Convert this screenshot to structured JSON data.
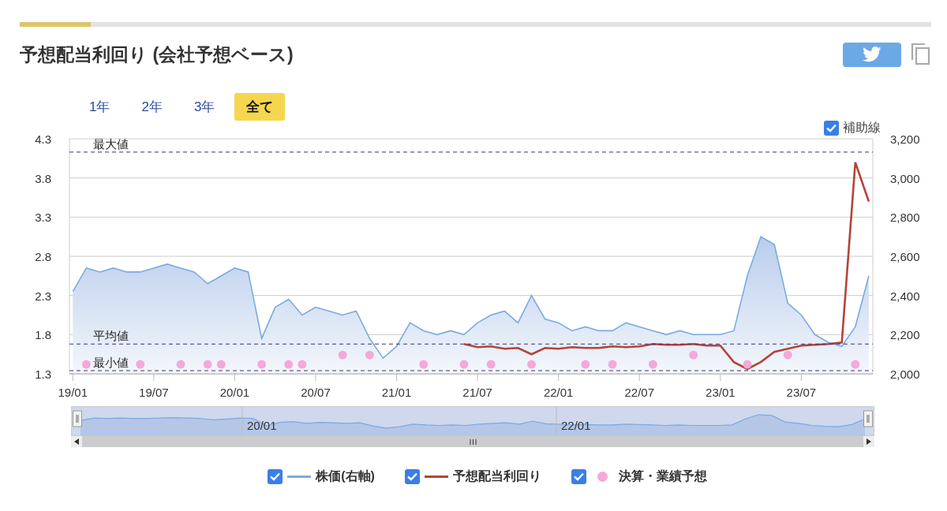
{
  "title": "予想配当利回り (会社予想ベース)",
  "share_buttons": [
    {
      "kind": "twitter"
    },
    {
      "kind": "copy"
    }
  ],
  "ranges": [
    {
      "label": "1年",
      "selected": false
    },
    {
      "label": "2年",
      "selected": false
    },
    {
      "label": "3年",
      "selected": false
    },
    {
      "label": "全て",
      "selected": true
    }
  ],
  "guides_toggle": {
    "label": "補助線",
    "checked": true
  },
  "chart": {
    "chart_data": {
      "type": "line",
      "categories": [
        "19/01",
        null,
        null,
        null,
        null,
        null,
        "19/07",
        null,
        null,
        null,
        null,
        null,
        "20/01",
        null,
        null,
        null,
        null,
        null,
        "20/07",
        null,
        null,
        null,
        null,
        null,
        "21/01",
        null,
        null,
        null,
        null,
        null,
        "21/07",
        null,
        null,
        null,
        null,
        null,
        "22/01",
        null,
        null,
        null,
        null,
        null,
        "22/07",
        null,
        null,
        null,
        null,
        null,
        "23/01",
        null,
        null,
        null,
        null,
        null,
        "23/07",
        null,
        null,
        null,
        null,
        null
      ],
      "ylim": [
        1.3,
        4.3
      ],
      "yticks": [
        {
          "value": 1.3,
          "label": "1.3"
        },
        {
          "value": 1.8,
          "label": "1.8"
        },
        {
          "value": 2.3,
          "label": "2.3"
        },
        {
          "value": 2.8,
          "label": "2.8"
        },
        {
          "value": 3.3,
          "label": "3.3"
        },
        {
          "value": 3.8,
          "label": "3.8"
        },
        {
          "value": 4.3,
          "label": "4.3"
        }
      ],
      "y2lim": [
        2000,
        3200
      ],
      "y2ticks": [
        {
          "value": 2000,
          "label": "2,000"
        },
        {
          "value": 2200,
          "label": "2,200"
        },
        {
          "value": 2400,
          "label": "2,400"
        },
        {
          "value": 2600,
          "label": "2,600"
        },
        {
          "value": 2800,
          "label": "2,800"
        },
        {
          "value": 3000,
          "label": "3,000"
        },
        {
          "value": 3200,
          "label": "3,200"
        }
      ],
      "series": [
        {
          "name": "株価(右軸)",
          "type": "area",
          "axis": "y2",
          "color": "#7aaae2",
          "values": [
            2420,
            2540,
            2520,
            2540,
            2520,
            2520,
            2540,
            2560,
            2540,
            2520,
            2460,
            2500,
            2540,
            2520,
            2180,
            2340,
            2380,
            2300,
            2340,
            2320,
            2300,
            2320,
            2180,
            2080,
            2140,
            2260,
            2220,
            2200,
            2220,
            2200,
            2260,
            2300,
            2320,
            2260,
            2400,
            2280,
            2260,
            2220,
            2240,
            2220,
            2220,
            2260,
            2240,
            2220,
            2200,
            2220,
            2200,
            2200,
            2200,
            2220,
            2500,
            2700,
            2660,
            2360,
            2300,
            2200,
            2160,
            2140,
            2240,
            2500
          ]
        },
        {
          "name": "予想配当利回り",
          "type": "line",
          "color": "#b5433a",
          "values": [
            null,
            null,
            null,
            null,
            null,
            null,
            null,
            null,
            null,
            null,
            null,
            null,
            null,
            null,
            null,
            null,
            null,
            null,
            null,
            null,
            null,
            null,
            null,
            null,
            null,
            null,
            null,
            null,
            null,
            1.68,
            1.64,
            1.65,
            1.62,
            1.63,
            1.55,
            1.63,
            1.62,
            1.64,
            1.63,
            1.63,
            1.65,
            1.64,
            1.65,
            1.68,
            1.67,
            1.67,
            1.68,
            1.66,
            1.66,
            1.45,
            1.36,
            1.45,
            1.58,
            1.62,
            1.66,
            1.67,
            1.68,
            1.7,
            4.0,
            3.5
          ]
        },
        {
          "name": "決算・業績予想",
          "type": "scatter",
          "color": "#f4a9d8",
          "values": [
            null,
            1.42,
            null,
            null,
            null,
            1.42,
            null,
            null,
            1.42,
            null,
            1.42,
            1.42,
            null,
            null,
            1.42,
            null,
            1.42,
            1.42,
            null,
            null,
            1.54,
            null,
            1.54,
            null,
            null,
            null,
            1.42,
            null,
            null,
            1.42,
            null,
            1.42,
            null,
            null,
            1.42,
            null,
            null,
            null,
            1.42,
            null,
            1.42,
            null,
            null,
            1.42,
            null,
            null,
            1.54,
            null,
            null,
            null,
            1.42,
            null,
            null,
            1.54,
            null,
            null,
            null,
            null,
            1.42,
            null
          ]
        }
      ],
      "grid": true,
      "ref_lines": [
        {
          "axis": "y",
          "label": "最大値",
          "value": 4.13
        },
        {
          "axis": "y",
          "label": "平均値",
          "value": 1.68
        },
        {
          "axis": "y",
          "label": "最小値",
          "value": 1.34
        }
      ]
    }
  },
  "navigator": {
    "labels": [
      "20/01",
      "22/01"
    ]
  },
  "legend": [
    {
      "checked": true
    },
    {
      "checked": true
    },
    {
      "checked": true
    }
  ]
}
